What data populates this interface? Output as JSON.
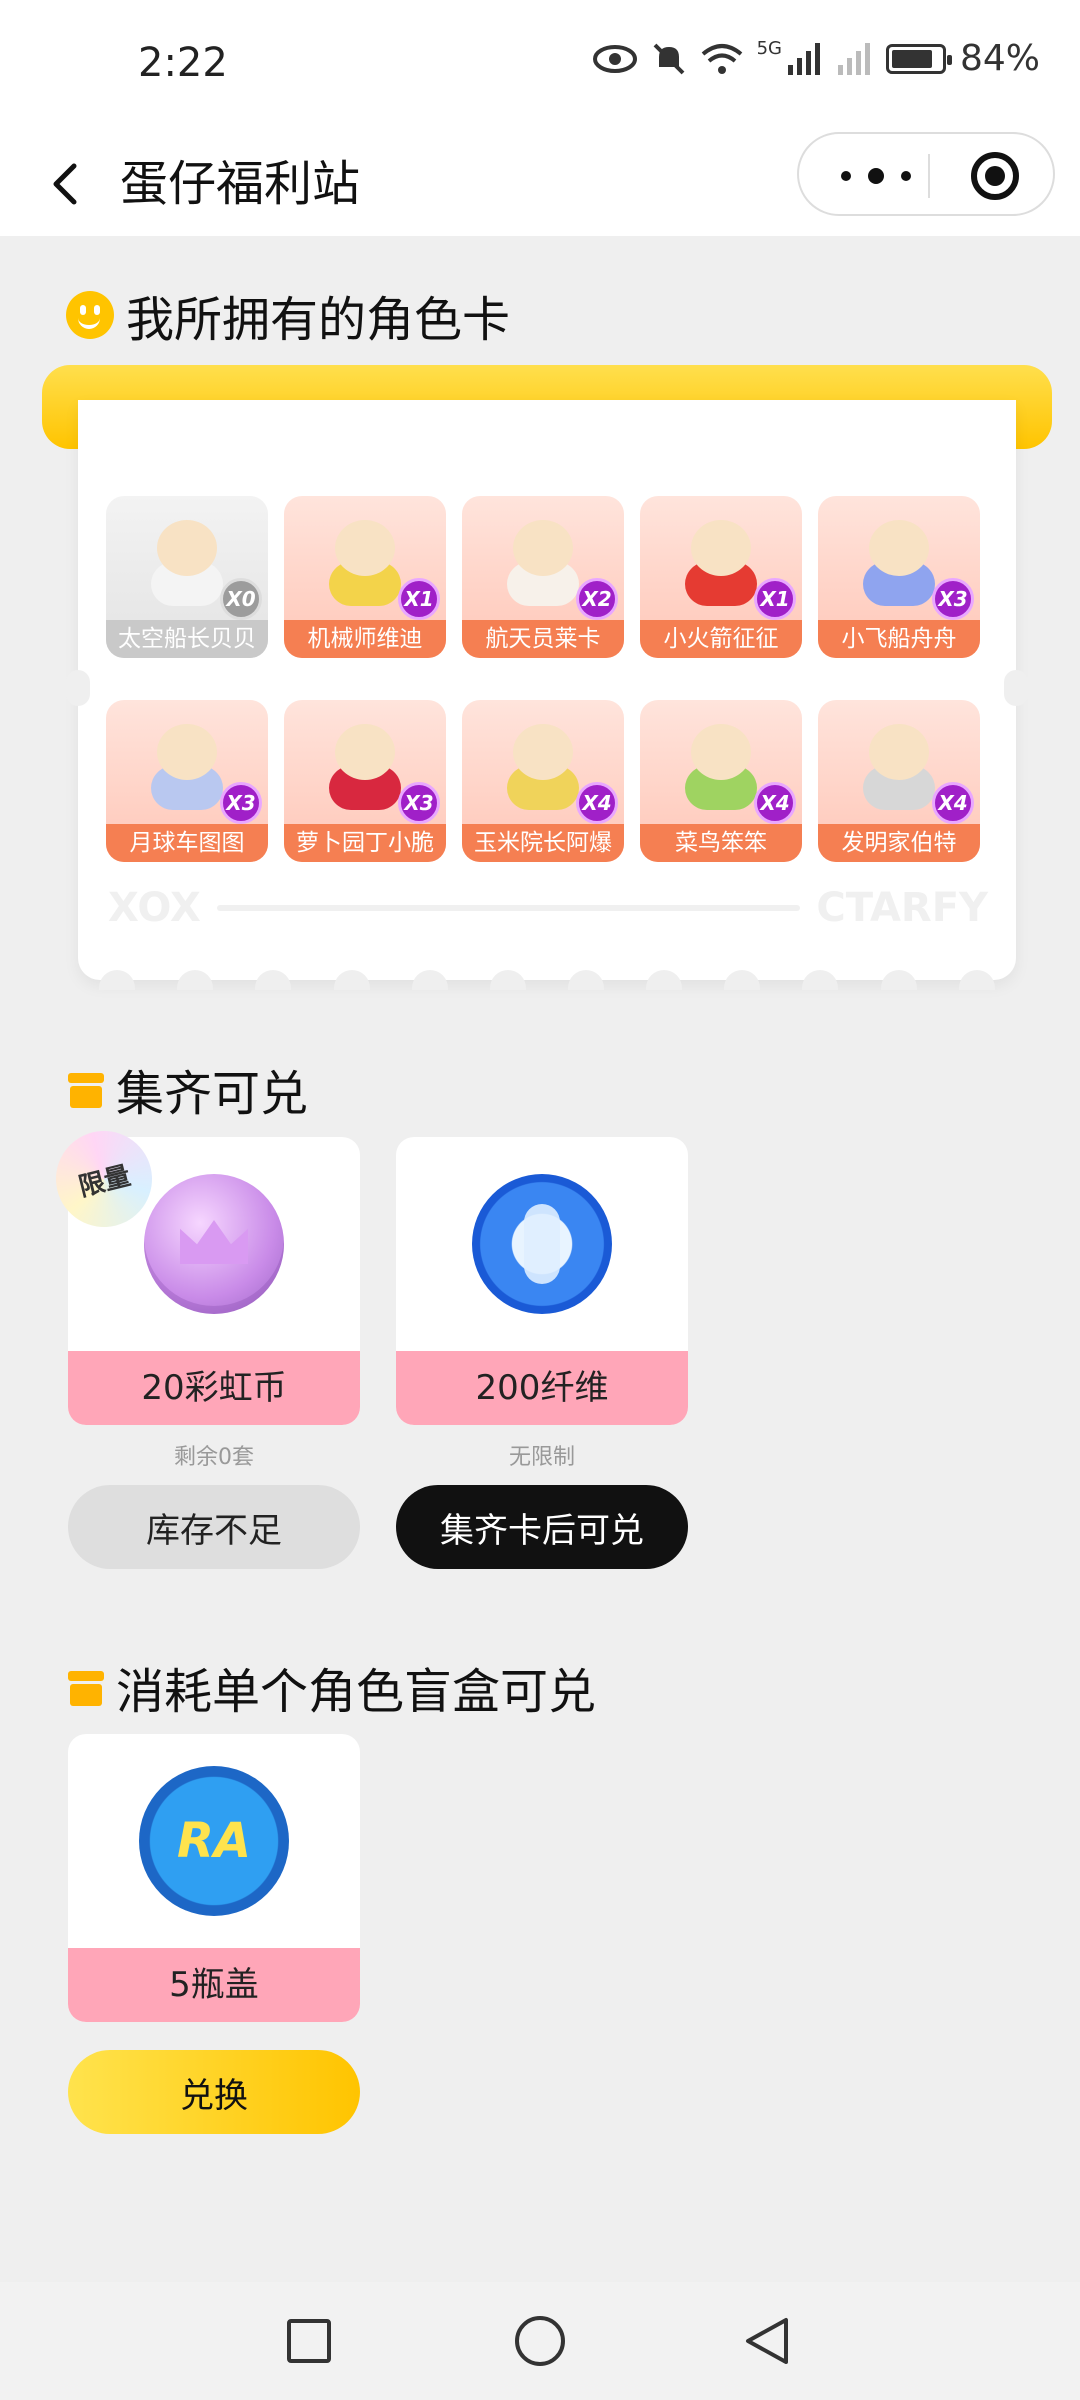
{
  "status_bar": {
    "time": "2:22",
    "network": "5G",
    "battery_percent": "84%",
    "battery_level": 0.84
  },
  "nav": {
    "title": "蛋仔福利站"
  },
  "sections": {
    "owned_cards": {
      "title": "我所拥有的角色卡"
    },
    "collect_redeem": {
      "title": "集齐可兑"
    },
    "consume_redeem": {
      "title": "消耗单个角色盲盒可兑"
    }
  },
  "characters": [
    {
      "name": "太空船长贝贝",
      "count": "X0",
      "owned": false
    },
    {
      "name": "机械师维迪",
      "count": "X1",
      "owned": true
    },
    {
      "name": "航天员莱卡",
      "count": "X2",
      "owned": true
    },
    {
      "name": "小火箭征征",
      "count": "X1",
      "owned": true
    },
    {
      "name": "小飞船舟舟",
      "count": "X3",
      "owned": true
    },
    {
      "name": "月球车图图",
      "count": "X3",
      "owned": true
    },
    {
      "name": "萝卜园丁小脆",
      "count": "X3",
      "owned": true
    },
    {
      "name": "玉米院长阿爆",
      "count": "X4",
      "owned": true
    },
    {
      "name": "菜鸟笨笨",
      "count": "X4",
      "owned": true
    },
    {
      "name": "发明家伯特",
      "count": "X4",
      "owned": true
    }
  ],
  "panel_footer": {
    "left": "XOX",
    "right": "CTARFY"
  },
  "collect_prizes": [
    {
      "tag": "限量",
      "label": "20彩虹币",
      "sub": "剩余0套",
      "button": "库存不足",
      "icon": "rainbow-coin-icon"
    },
    {
      "label": "200纤维",
      "sub": "无限制",
      "button": "集齐卡后可兑",
      "icon": "fiber-orb-icon"
    }
  ],
  "consume_prizes": [
    {
      "label": "5瓶盖",
      "button": "兑换",
      "icon": "bottle-cap-icon",
      "cap_text": "RA"
    }
  ],
  "colors": {
    "accent_yellow": "#ffc400",
    "card_orange": "#f57f52",
    "prize_pink": "#ffa6b8"
  }
}
